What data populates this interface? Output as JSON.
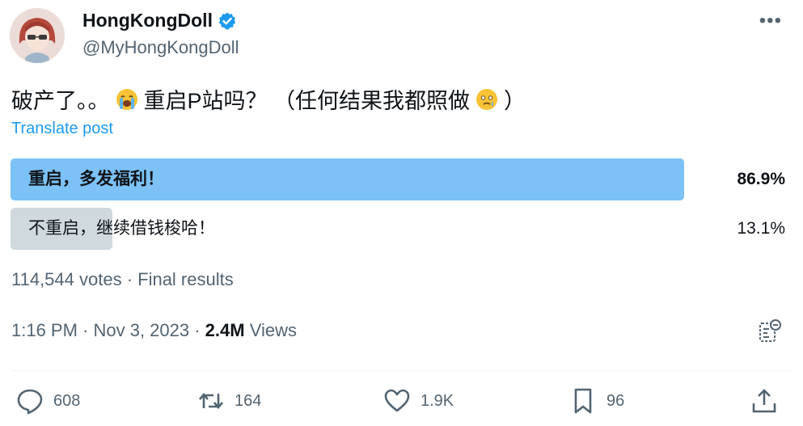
{
  "author": {
    "name": "HongKongDoll",
    "handle": "@MyHongKongDoll",
    "verified": true,
    "avatar_icon": "avatar-icon"
  },
  "tweet": {
    "text_part1": "破产了。。",
    "emoji1": "loudly-crying-face",
    "text_part2": "重启P站吗？ （任何结果我都照做",
    "emoji2": "face-holding-back-tears",
    "text_part3": "）",
    "translate_label": "Translate post"
  },
  "poll": {
    "options": [
      {
        "label": "重启，多发福利！",
        "percent_text": "86.9%",
        "fraction": 0.869,
        "winner": true
      },
      {
        "label": "不重启，继续借钱梭哈！",
        "percent_text": "13.1%",
        "fraction": 0.131,
        "winner": false
      }
    ],
    "summary": "114,544 votes · Final results"
  },
  "meta": {
    "time": "1:16 PM · Nov 3, 2023 · ",
    "views_count": "2.4M",
    "views_label": " Views"
  },
  "actions": {
    "replies": "608",
    "reposts": "164",
    "likes": "1.9K",
    "bookmarks": "96"
  },
  "colors": {
    "accent": "#1d9bf0",
    "poll_winner": "#7cc2f7",
    "poll_other": "#cfd9de",
    "muted_text": "#536471"
  }
}
